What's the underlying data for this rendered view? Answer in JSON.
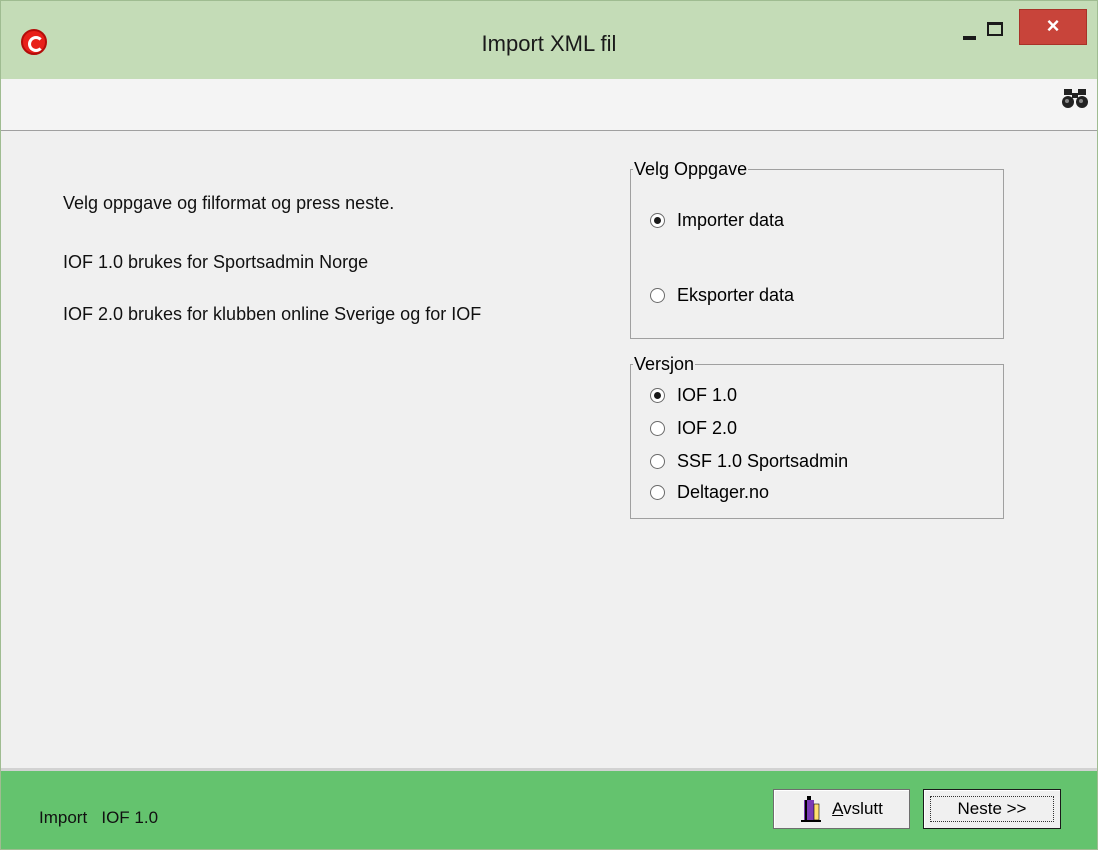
{
  "window": {
    "title": "Import XML fil",
    "close_glyph": "×"
  },
  "main": {
    "instruction": "Velg oppgave og filformat og press neste.",
    "note1": "IOF 1.0 brukes for Sportsadmin Norge",
    "note2": "IOF 2.0 brukes for klubben online Sverige og for IOF"
  },
  "task_group": {
    "legend": "Velg Oppgave",
    "options": [
      {
        "label": "Importer data",
        "checked": true
      },
      {
        "label": "Eksporter data",
        "checked": false
      }
    ]
  },
  "version_group": {
    "legend": "Versjon",
    "options": [
      {
        "label": "IOF 1.0",
        "checked": true
      },
      {
        "label": "IOF 2.0",
        "checked": false
      },
      {
        "label": "SSF 1.0 Sportsadmin",
        "checked": false
      },
      {
        "label": "Deltager.no",
        "checked": false
      }
    ]
  },
  "status": {
    "mode": "Import",
    "version": "IOF 1.0"
  },
  "buttons": {
    "exit_accel": "A",
    "exit_rest": "vslutt",
    "next": "Neste >>"
  },
  "icons": {
    "app": "app-logo-icon",
    "search": "binoculars-icon",
    "exit": "door-exit-icon"
  },
  "colors": {
    "titlebar": "#c4dcb7",
    "statusbar": "#64c36e",
    "close": "#c8443a"
  }
}
